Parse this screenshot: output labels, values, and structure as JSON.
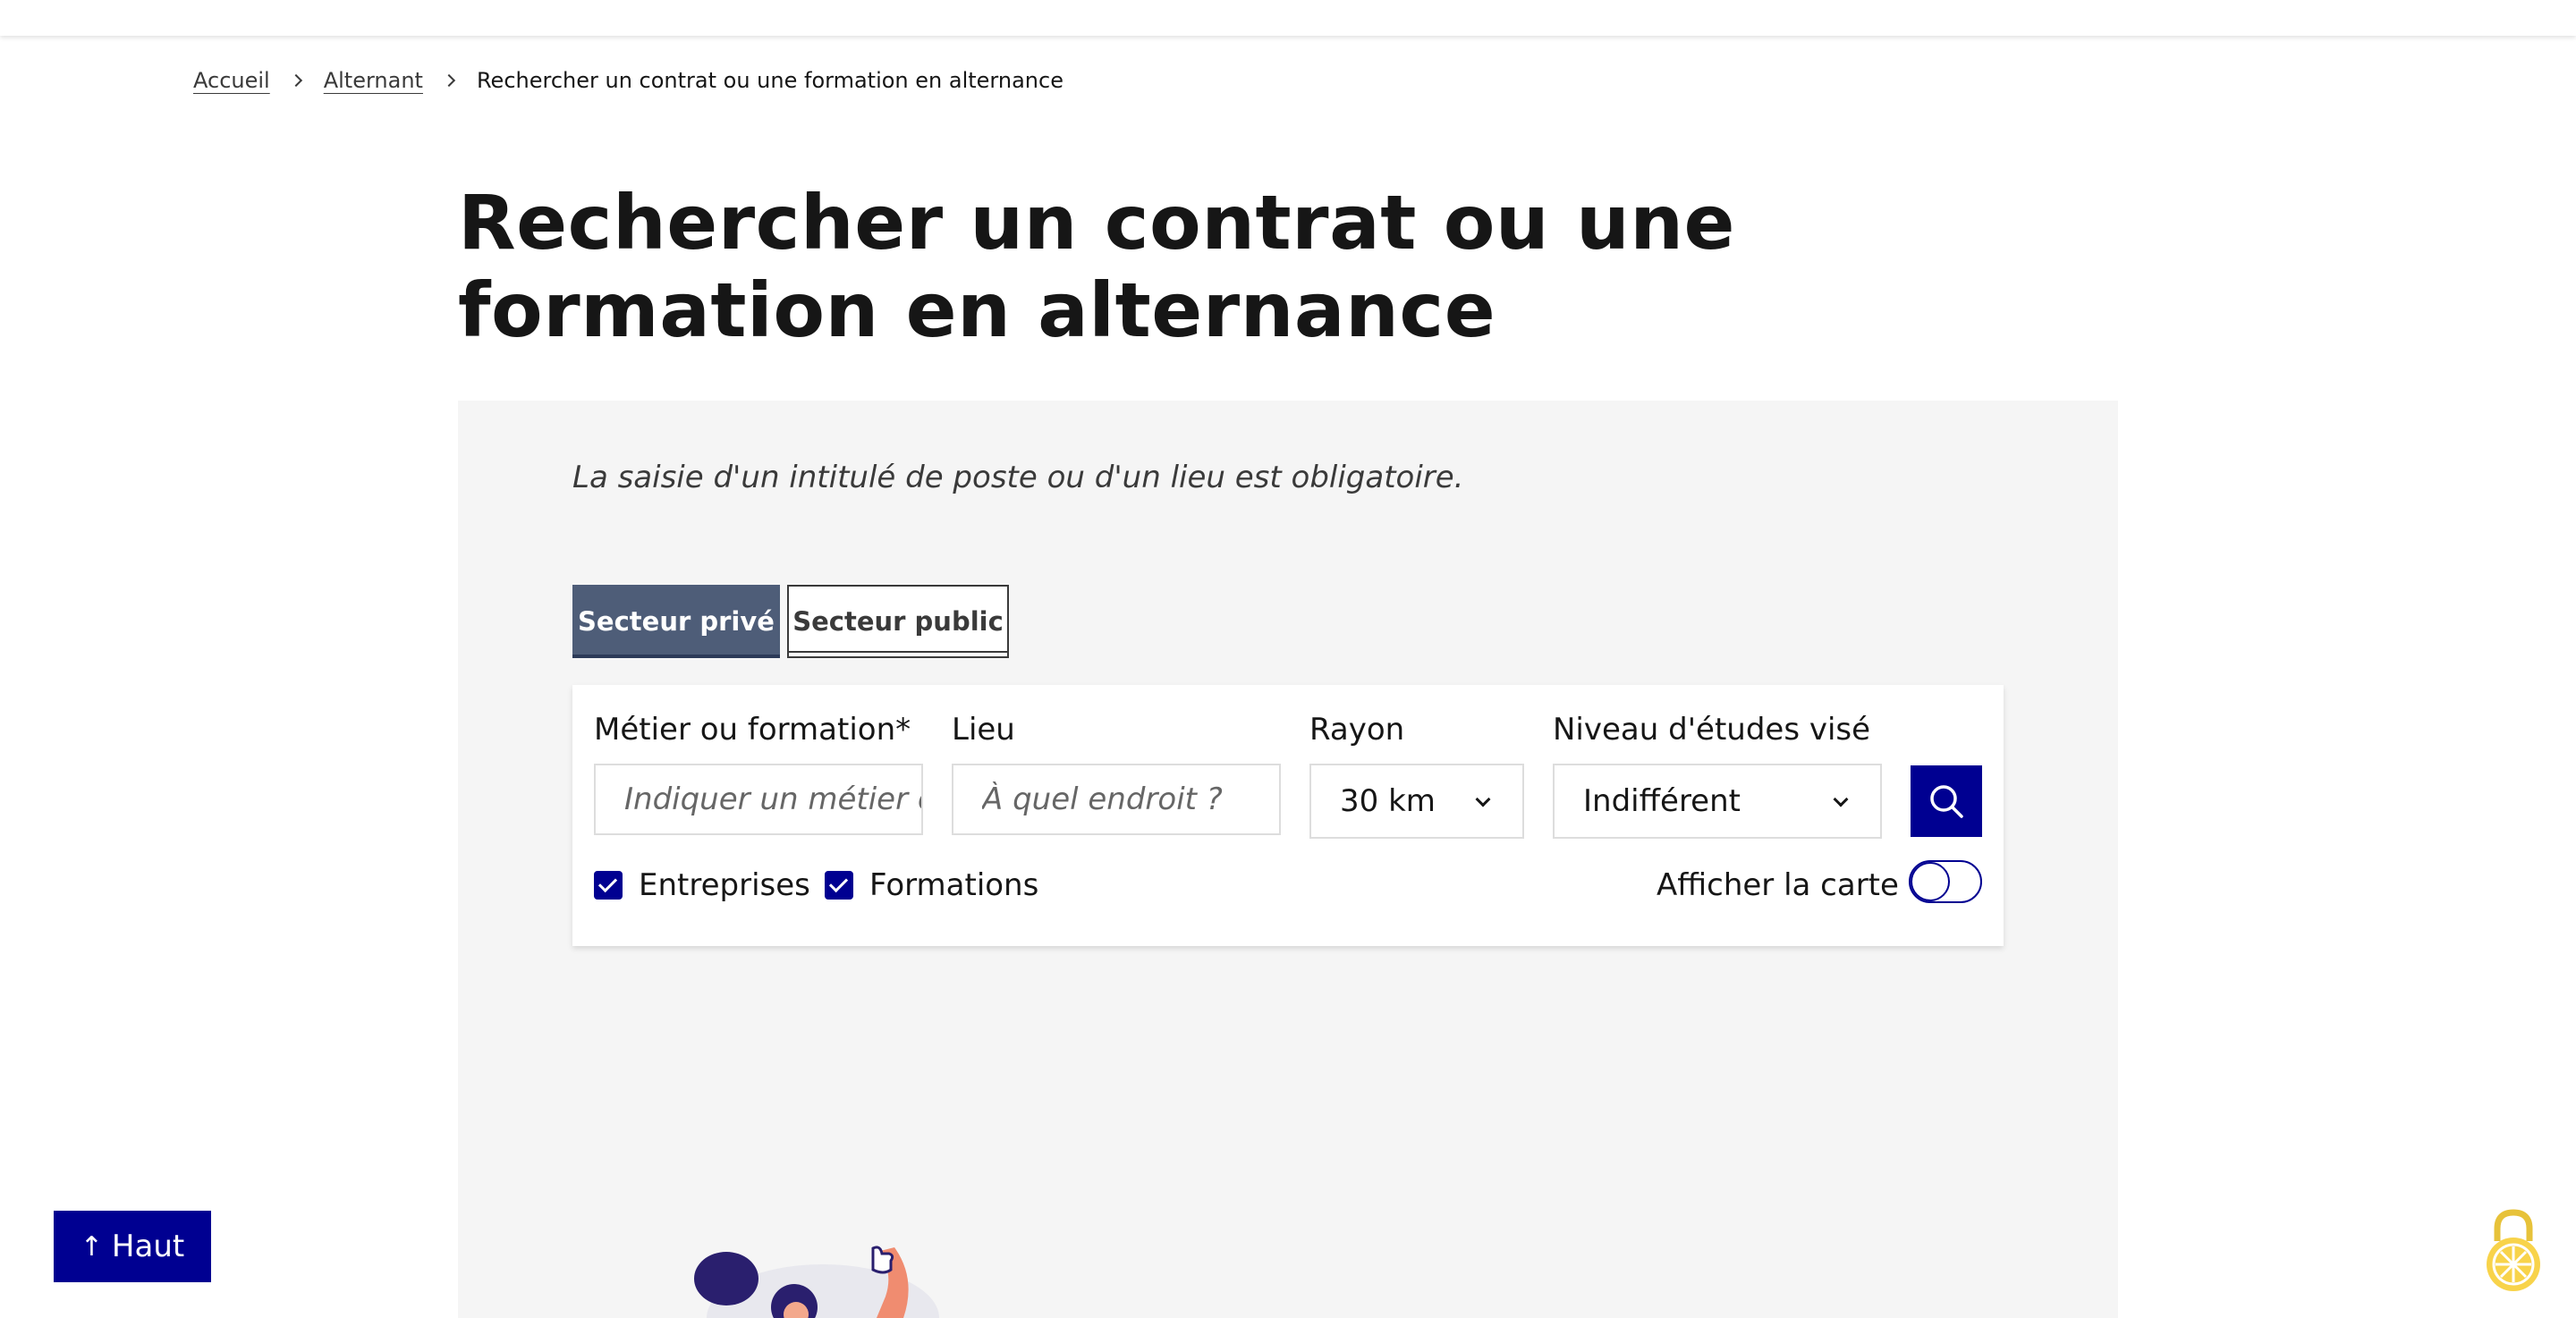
{
  "breadcrumb": {
    "items": [
      "Accueil",
      "Alternant"
    ],
    "current": "Rechercher un contrat ou une formation en alternance"
  },
  "page": {
    "title": "Rechercher un contrat ou une formation en alternance"
  },
  "search": {
    "mandatory_notice": "La saisie d'un intitulé de poste ou d'un lieu est obligatoire.",
    "tabs": [
      {
        "label": "Secteur privé",
        "selected": true
      },
      {
        "label": "Secteur public",
        "selected": false
      }
    ],
    "metier": {
      "label": "Métier ou formation",
      "required_mark": "*",
      "placeholder": "Indiquer un métier ou une formation"
    },
    "lieu": {
      "label": "Lieu",
      "placeholder": "À quel endroit ?"
    },
    "rayon": {
      "label": "Rayon",
      "value": "30 km"
    },
    "niveau": {
      "label": "Niveau d'études visé",
      "value": "Indifférent"
    },
    "submit_icon": "search-icon",
    "checkboxes": [
      {
        "label": "Entreprises",
        "checked": true
      },
      {
        "label": "Formations",
        "checked": true
      }
    ],
    "map_toggle": {
      "label": "Afficher la carte",
      "on": false
    }
  },
  "back_to_top": {
    "label": "Haut",
    "icon": "arrow-up-icon"
  },
  "colors": {
    "primary": "#000091",
    "tab_selected": "#4e5d78",
    "panel_bg": "#f5f5f5",
    "badge_yellow": "#f8d34a"
  }
}
